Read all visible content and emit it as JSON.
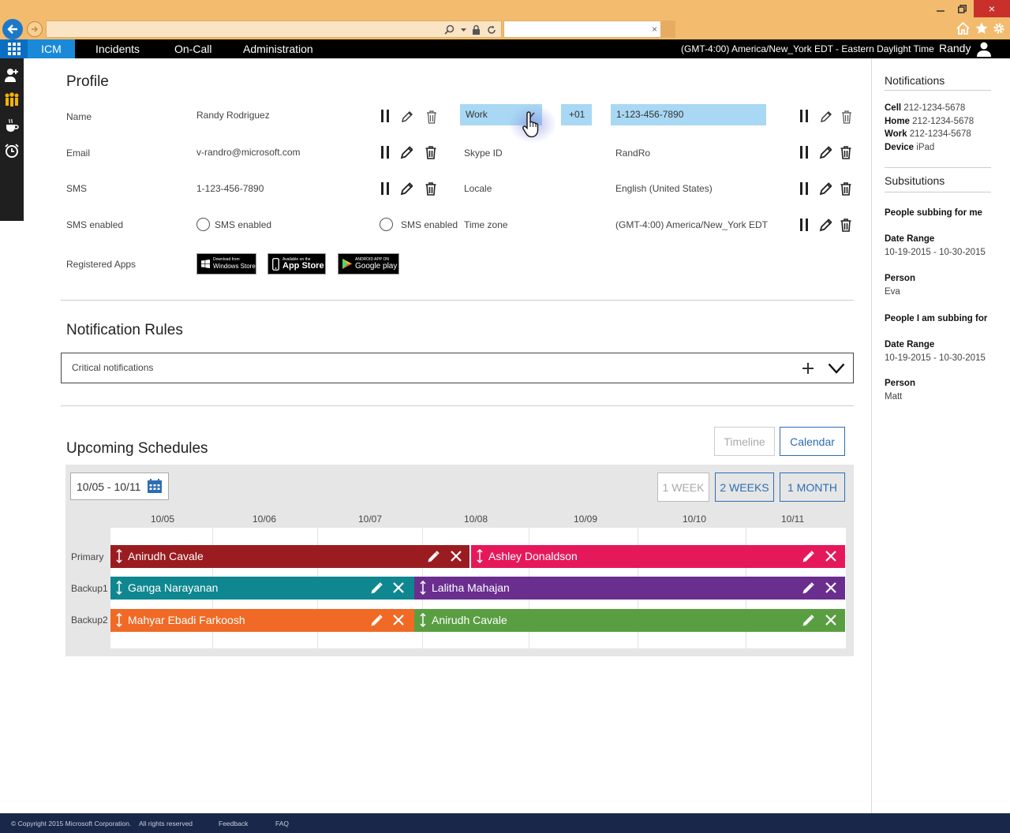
{
  "browser": {
    "close_glyph": "×",
    "tab_close": "×"
  },
  "app": {
    "brand": "ICM",
    "tabs": [
      "Incidents",
      "On-Call",
      "Administration"
    ],
    "timezone": "(GMT-4:00) America/New_York EDT - Eastern Daylight Time",
    "user": "Randy"
  },
  "profile": {
    "title": "Profile",
    "rows": [
      {
        "label": "Name",
        "value": "Randy Rodriguez"
      },
      {
        "label": "Email",
        "value": "v-randro@microsoft.com"
      },
      {
        "label": "SMS",
        "value": "1-123-456-7890"
      },
      {
        "label": "SMS enabled",
        "value": "SMS enabled",
        "value2": "SMS enabled"
      },
      {
        "label": "Registered Apps"
      }
    ],
    "contact": {
      "phone_type": "Work",
      "country_code": "+01",
      "phone_number": "1-123-456-7890"
    },
    "right_rows": [
      {
        "label": "Skype ID",
        "value": "RandRo"
      },
      {
        "label": "Locale",
        "value": "English (United States)"
      },
      {
        "label": "Time zone",
        "value": "(GMT-4:00) America/New_York EDT"
      }
    ],
    "apps": [
      {
        "small": "Download from",
        "big": "Windows Store"
      },
      {
        "small": "Available on the",
        "big": "App Store"
      },
      {
        "small": "ANDROID APP ON",
        "big": "Google play"
      }
    ]
  },
  "notification_rules": {
    "title": "Notification Rules",
    "rule": "Critical notifications"
  },
  "schedules": {
    "title": "Upcoming Schedules",
    "view_timeline": "Timeline",
    "view_calendar": "Calendar",
    "date_range": "10/05 - 10/11",
    "range_week": "1 WEEK",
    "range_two_weeks": "2 WEEKS",
    "range_month": "1 MONTH",
    "days": [
      "10/05",
      "10/06",
      "10/07",
      "10/08",
      "10/09",
      "10/10",
      "10/11"
    ],
    "roles": [
      "Primary",
      "Backup1",
      "Backup2"
    ],
    "shifts": [
      {
        "role": "Primary",
        "person": "Anirudh Cavale",
        "color": "#9b1c20"
      },
      {
        "role": "Primary",
        "person": "Ashley Donaldson",
        "color": "#e5195a"
      },
      {
        "role": "Backup1",
        "person": "Ganga Narayanan",
        "color": "#0f8790"
      },
      {
        "role": "Backup1",
        "person": "Lalitha Mahajan",
        "color": "#6a2e8f"
      },
      {
        "role": "Backup2",
        "person": "Mahyar Ebadi Farkoosh",
        "color": "#f06a25"
      },
      {
        "role": "Backup2",
        "person": "Anirudh Cavale",
        "color": "#5a9e42"
      }
    ]
  },
  "notifications_panel": {
    "title": "Notifications",
    "cell_label": "Cell",
    "cell": "212-1234-5678",
    "home_label": "Home",
    "home": "212-1234-5678",
    "work_label": "Work",
    "work": "212-1234-5678",
    "device_label": "Device",
    "device": "iPad",
    "subs_title": "Subsitutions",
    "subbing_for_me": "People subbing for me",
    "date_range_label": "Date Range",
    "date_range_1": "10-19-2015 - 10-30-2015",
    "person_label": "Person",
    "person_1": "Eva",
    "i_am_subbing": "People I am subbing for",
    "date_range_2": "10-19-2015 - 10-30-2015",
    "person_2": "Matt"
  },
  "footer": {
    "copyright": "© Copyright 2015 Microsoft Corporation.",
    "rights": "All rights reserved",
    "feedback": "Feedback",
    "faq": "FAQ"
  }
}
